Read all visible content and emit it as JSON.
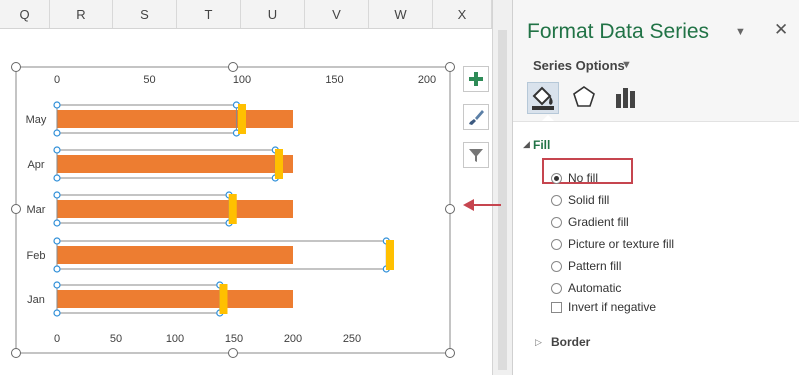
{
  "columns": [
    "Q",
    "R",
    "S",
    "T",
    "U",
    "V",
    "W",
    "X"
  ],
  "chart_data": {
    "type": "bar",
    "orientation": "horizontal",
    "categories": [
      "May",
      "Apr",
      "Mar",
      "Feb",
      "Jan"
    ],
    "series": [
      {
        "values": [
          200,
          200,
          200,
          200,
          200
        ],
        "color": "#ed7d31",
        "axis": "primary"
      },
      {
        "values": [
          97,
          118,
          93,
          178,
          88
        ],
        "color": "none",
        "axis": "secondary",
        "selected": true
      },
      {
        "values": [
          100,
          120,
          95,
          180,
          90
        ],
        "color": "#ffc000",
        "axis": "secondary",
        "marker": true
      }
    ],
    "primary_axis": {
      "position": "bottom",
      "ticks": [
        "0",
        "50",
        "100",
        "150",
        "200",
        "250"
      ],
      "range": [
        0,
        250
      ]
    },
    "secondary_axis": {
      "position": "top",
      "ticks": [
        "0",
        "50",
        "100",
        "150",
        "200"
      ],
      "range": [
        0,
        200
      ]
    }
  },
  "chart_buttons": [
    "chart-elements",
    "chart-styles",
    "chart-filters"
  ],
  "pane": {
    "title": "Format Data Series",
    "series_options": "Series Options",
    "fill_heading": "Fill",
    "options": [
      "No fill",
      "Solid fill",
      "Gradient fill",
      "Picture or texture fill",
      "Pattern fill",
      "Automatic"
    ],
    "selected_option": "No fill",
    "invert_label": "Invert if negative",
    "border_heading": "Border"
  },
  "colors": {
    "accent": "#217346",
    "bar": "#ed7d31",
    "marker": "#ffc000",
    "highlight": "#c6454f"
  }
}
